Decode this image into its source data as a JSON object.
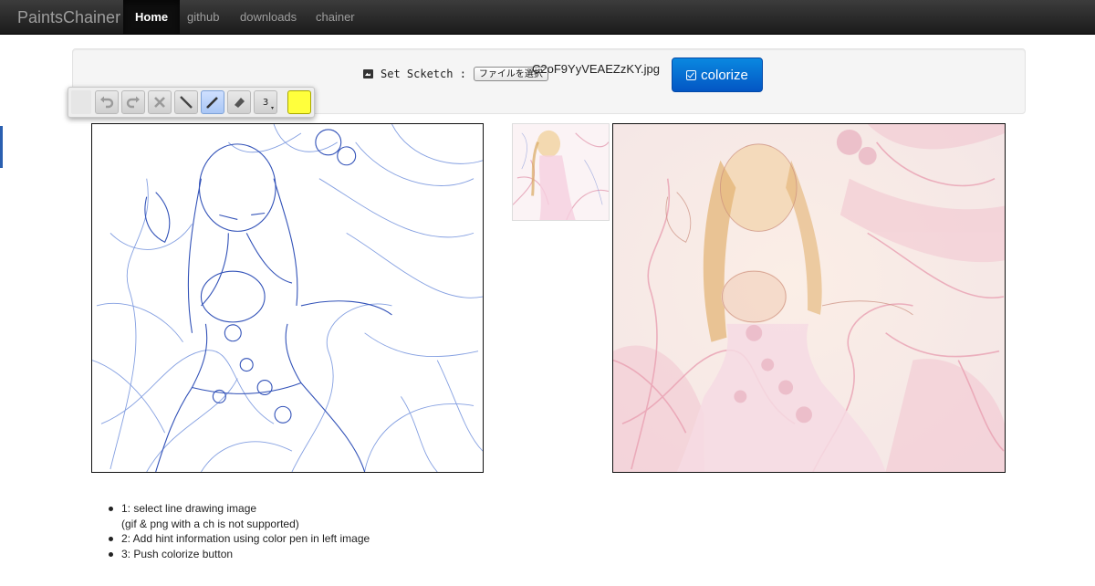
{
  "navbar": {
    "brand": "PaintsChainer",
    "items": [
      {
        "label": "Home",
        "active": true
      },
      {
        "label": "github",
        "active": false
      },
      {
        "label": "downloads",
        "active": false
      },
      {
        "label": "chainer",
        "active": false
      }
    ]
  },
  "upload": {
    "label": "Set Scketch :",
    "file_button": "ファイルを選択",
    "file_name": "C2oF9YyVEAEZzKY.jpg",
    "colorize_label": "colorize"
  },
  "toolbar": {
    "tools": [
      "undo-icon",
      "redo-icon",
      "clear-icon",
      "line-icon",
      "pen-icon",
      "eraser-icon"
    ],
    "selected_tool": "pen-icon",
    "pen_width": "3",
    "pen_color": "#ffff3c"
  },
  "colors": {
    "navbar": "#1b1b1b",
    "accent": "#0a6fd6",
    "sketch_lines": "#3a5fc8"
  },
  "instructions": [
    "1: select line drawing image",
    "(gif & png with a ch is not supported)",
    "2: Add hint information using color pen in left image",
    "3: Push colorize button"
  ]
}
